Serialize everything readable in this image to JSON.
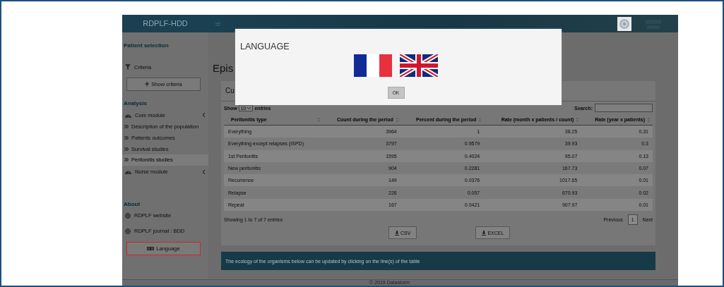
{
  "header": {
    "brand": "RDPLF-HDD"
  },
  "sidebar": [
    {
      "kind": "heading",
      "label": "Patient selection"
    },
    {
      "kind": "link",
      "label": "Criteria"
    },
    {
      "kind": "button",
      "label": "Show criteria",
      "highlighted": false
    },
    {
      "kind": "heading",
      "label": "Analysis"
    },
    {
      "kind": "menu",
      "label": "Core module",
      "expanded": true,
      "children": [
        {
          "label": "Description of the population",
          "selected": false
        },
        {
          "label": "Patients outcomes",
          "selected": false
        },
        {
          "label": "Survival studies",
          "selected": false
        },
        {
          "label": "Peritonitis studies",
          "selected": true
        }
      ]
    },
    {
      "kind": "menu",
      "label": "Nurse module",
      "expanded": false
    },
    {
      "kind": "heading",
      "label": "About"
    },
    {
      "kind": "link",
      "label": "RDPLF website"
    },
    {
      "kind": "link",
      "label": "RDPLF journal : BDD"
    },
    {
      "kind": "button",
      "label": "Language",
      "highlighted": true
    }
  ],
  "main": {
    "page_title": "Epis",
    "card_title": "Cu",
    "table": {
      "length_label_before": "Show",
      "length_value": "10",
      "length_label_after": "entries",
      "search_label": "Search:",
      "columns": [
        "Peritonitis type",
        "Count during the period",
        "Percent during the period",
        "Rate (month x patients / count)",
        "Rate (year x patients)"
      ],
      "rows": [
        [
          "Everything",
          "3964",
          "1",
          "38.25",
          "0.31"
        ],
        [
          "Everything except relapses (ISPD)",
          "3797",
          "0.9579",
          "39.93",
          "0.3"
        ],
        [
          "1st Peritonitis",
          "1595",
          "0.4024",
          "95.07",
          "0.13"
        ],
        [
          "New peritonitis",
          "904",
          "0.2281",
          "167.73",
          "0.07"
        ],
        [
          "Recurrence",
          "149",
          "0.0376",
          "1017.65",
          "0.01"
        ],
        [
          "Relapse",
          "226",
          "0.057",
          "670.93",
          "0.02"
        ],
        [
          "Repeat",
          "167",
          "0.0421",
          "907.97",
          "0.01"
        ]
      ],
      "info": "Showing 1 to 7 of 7 entries",
      "previous": "Previous",
      "pages": [
        {
          "label": "1",
          "selected": true
        }
      ],
      "next": "Next"
    },
    "export_buttons": [
      "CSV",
      "EXCEL"
    ],
    "info_banner": "The ecology of the organisms below can be updated by clicking on the line(s) of the table"
  },
  "footer": "© 2019 Datastorm",
  "modal": {
    "title": "LANGUAGE",
    "flags": [
      {
        "kind": "france"
      },
      {
        "kind": "uk"
      }
    ],
    "ok": "OK"
  }
}
